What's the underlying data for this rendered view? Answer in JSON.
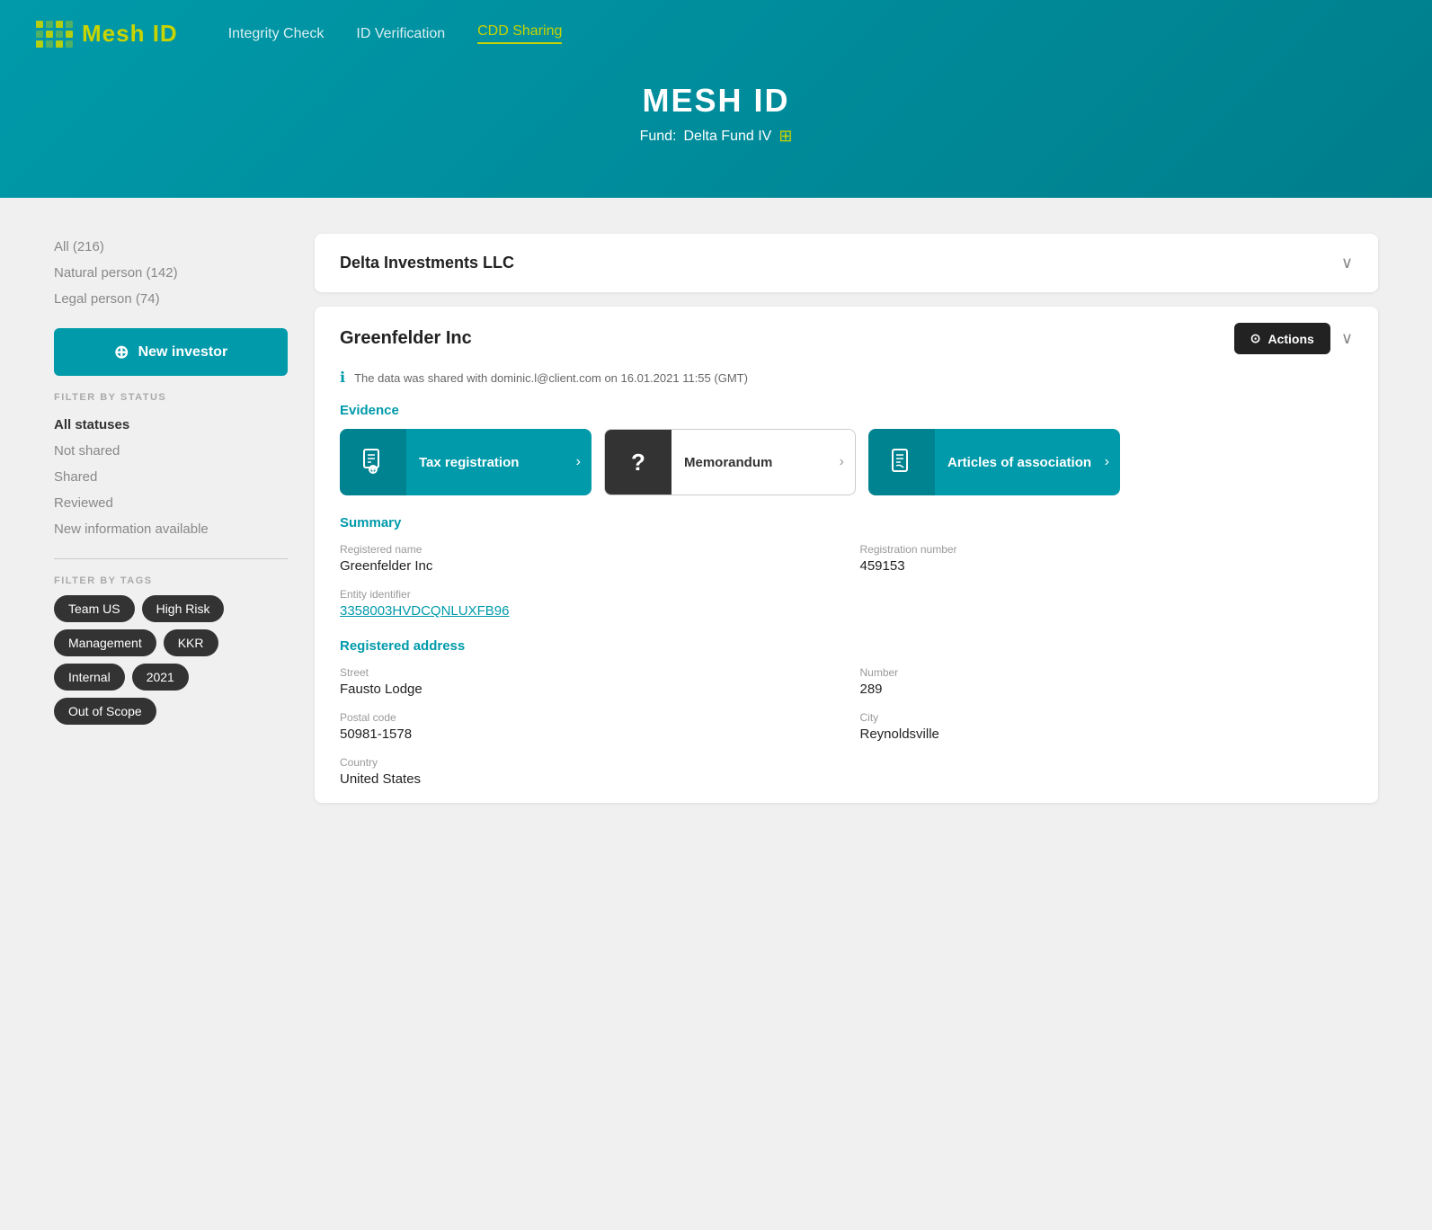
{
  "header": {
    "logo_text": "Mesh ",
    "logo_accent": "ID",
    "nav_items": [
      {
        "label": "Integrity Check",
        "active": false
      },
      {
        "label": "ID Verification",
        "active": false
      },
      {
        "label": "CDD Sharing",
        "active": true
      }
    ],
    "main_title": "MESH ID",
    "fund_label": "Fund:",
    "fund_name": "Delta Fund IV"
  },
  "sidebar": {
    "filter_status_label": "FILTER BY STATUS",
    "filter_tags_label": "FILTER BY TAGS",
    "filters": [
      {
        "label": "All (216)",
        "active": false
      },
      {
        "label": "Natural person (142)",
        "active": false
      },
      {
        "label": "Legal person (74)",
        "active": false
      }
    ],
    "new_investor_label": "New investor",
    "status_filters": [
      {
        "label": "All statuses",
        "active": true
      },
      {
        "label": "Not shared",
        "active": false
      },
      {
        "label": "Shared",
        "active": false
      },
      {
        "label": "Reviewed",
        "active": false
      },
      {
        "label": "New information available",
        "active": false
      }
    ],
    "tags": [
      {
        "label": "Team US"
      },
      {
        "label": "High Risk"
      },
      {
        "label": "Management"
      },
      {
        "label": "KKR"
      },
      {
        "label": "Internal"
      },
      {
        "label": "2021"
      },
      {
        "label": "Out of Scope"
      }
    ]
  },
  "collapsed_card": {
    "title": "Delta Investments LLC"
  },
  "expanded_card": {
    "title": "Greenfelder Inc",
    "actions_label": "Actions",
    "info_text": "The data was shared with dominic.l@client.com on 16.01.2021 11:55 (GMT)",
    "evidence_label": "Evidence",
    "evidence_items": [
      {
        "label": "Tax registration",
        "type": "filled"
      },
      {
        "label": "Memorandum",
        "type": "outline"
      },
      {
        "label": "Articles of association",
        "type": "filled"
      }
    ],
    "summary_label": "Summary",
    "summary_fields": [
      {
        "label": "Registered name",
        "value": "Greenfelder Inc",
        "col": 0
      },
      {
        "label": "Registration number",
        "value": "459153",
        "col": 1
      },
      {
        "label": "Entity identifier",
        "value": "3358003HVDCQNLUXFB96",
        "col": 0,
        "full": true
      }
    ],
    "registered_address_label": "Registered address",
    "address_fields": [
      {
        "label": "Street",
        "value": "Fausto Lodge"
      },
      {
        "label": "Number",
        "value": "289"
      },
      {
        "label": "Postal code",
        "value": "50981-1578"
      },
      {
        "label": "City",
        "value": "Reynoldsville"
      },
      {
        "label": "Country",
        "value": "United States"
      }
    ]
  }
}
